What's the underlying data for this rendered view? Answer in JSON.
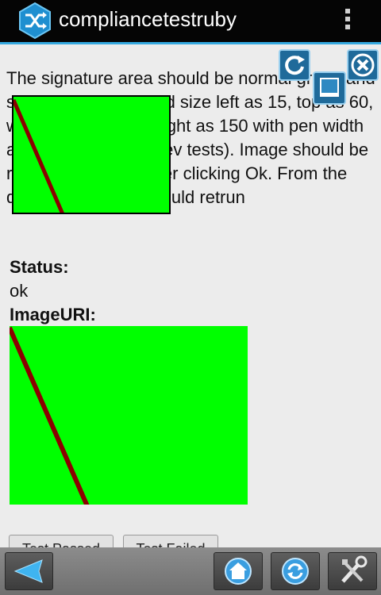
{
  "app": {
    "title": "compliancetestruby",
    "icon": "shuffle-icon"
  },
  "test": {
    "description": "The signature area should be normal green and should be of specified size left as 15, top as 60, width as 200 and height as 150 with pen width as 5(thickest than prev tests). Image should be rendered in page after clicking Ok. From the dataURI, no path should retrun",
    "status_label": "Status:",
    "status_value": "ok",
    "imageuri_label": "ImageURI:"
  },
  "buttons": {
    "passed": "Test Passed",
    "failed": "Test Failed"
  },
  "signature": {
    "background": "#00ff00",
    "pen_color": "#8b0000"
  },
  "controls": {
    "refresh_icon": "refresh-icon",
    "close_icon": "close-icon",
    "minimize_icon": "minimize-icon"
  },
  "toolbar": {
    "back_icon": "back-icon",
    "home_icon": "home-icon",
    "sync_icon": "sync-icon",
    "settings_icon": "settings-icon"
  }
}
